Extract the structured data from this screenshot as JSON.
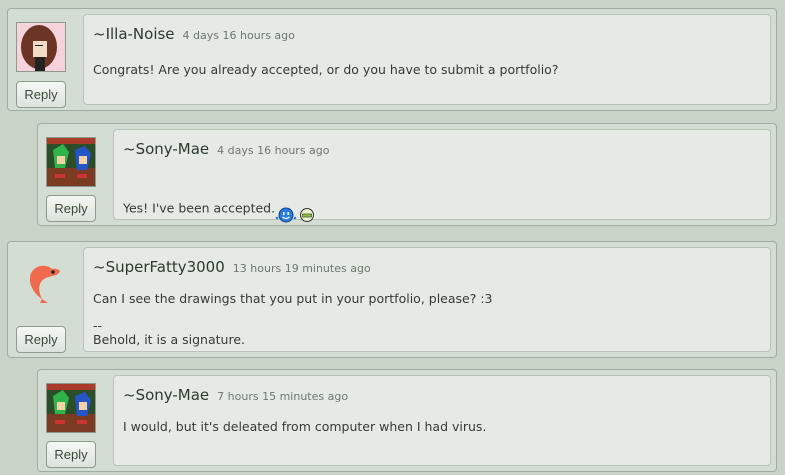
{
  "comments": [
    {
      "username": "~Illa-Noise",
      "timestamp": "4 days 16 hours ago",
      "text": "Congrats! Are you already accepted, or do you have to submit a portfolio?",
      "reply_label": "Reply",
      "avatar_icon": "girl-avatar"
    },
    {
      "username": "~Sony-Mae",
      "timestamp": "4 days 16 hours ago",
      "text": "Yes! I've been accepted.",
      "emoticons": [
        "blue-smiley-icon",
        "green-grin-icon"
      ],
      "reply_label": "Reply",
      "avatar_icon": "sonic-avatar"
    },
    {
      "username": "~SuperFatty3000",
      "timestamp": "13 hours 19 minutes ago",
      "text": "Can I see the drawings that you put in your portfolio, please? :3",
      "signature_sep": "--",
      "signature": "Behold, it is a signature.",
      "reply_label": "Reply",
      "avatar_icon": "shrimp-avatar"
    },
    {
      "username": "~Sony-Mae",
      "timestamp": "7 hours 15 minutes ago",
      "text": "I would, but it's deleated from computer when I had virus.",
      "reply_label": "Reply",
      "avatar_icon": "sonic-avatar"
    }
  ],
  "colors": {
    "page_bg": "#c9d3c8",
    "bubble_bg": "#e5ebe4",
    "username": "#2d3a2d",
    "timestamp": "#6c796c"
  }
}
